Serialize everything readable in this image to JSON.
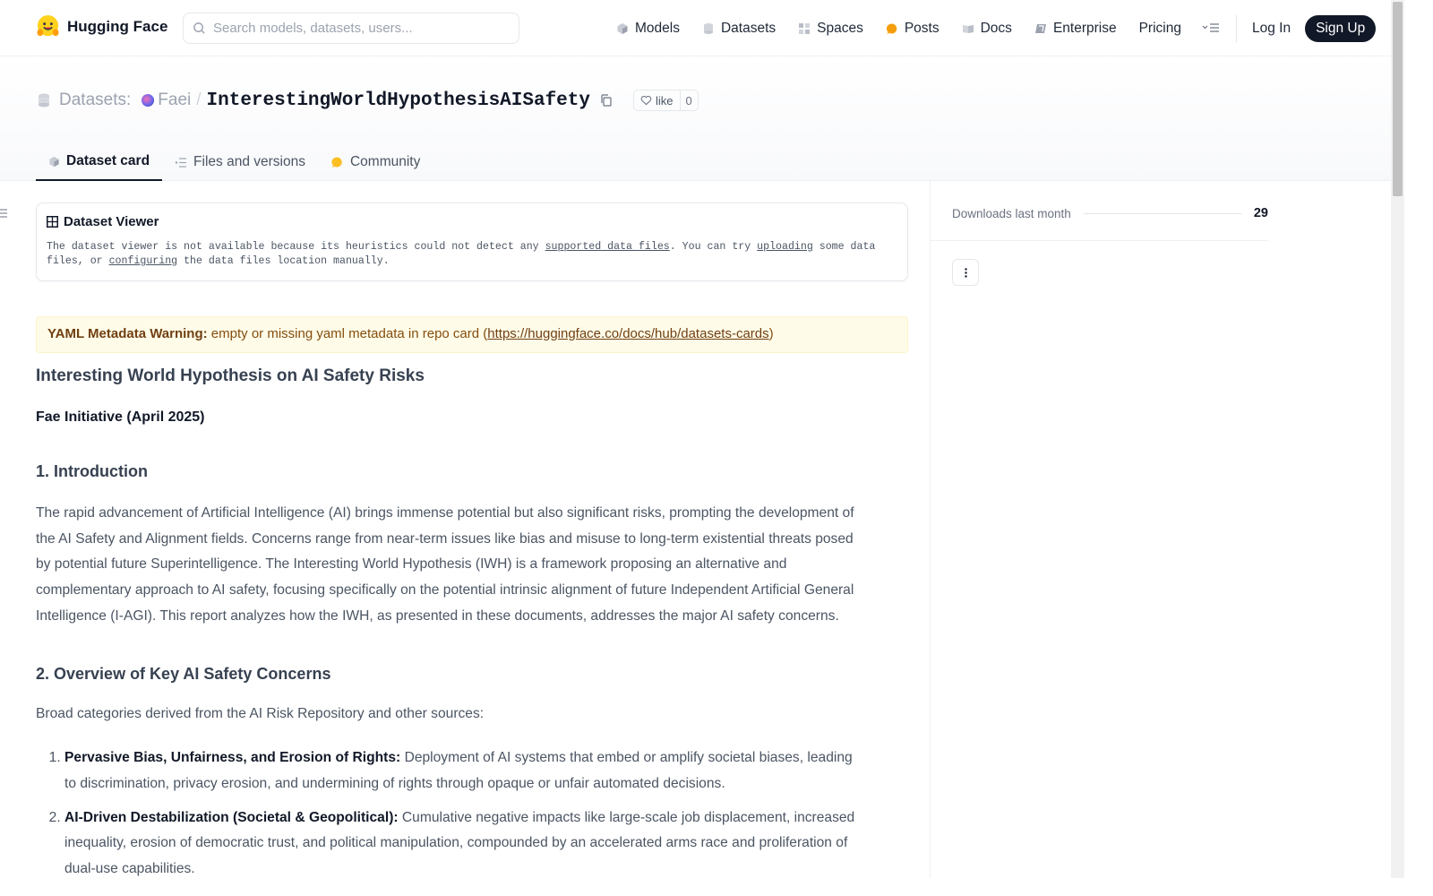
{
  "header": {
    "brand": "Hugging Face",
    "search_placeholder": "Search models, datasets, users...",
    "nav": [
      {
        "label": "Models",
        "icon": "models-icon"
      },
      {
        "label": "Datasets",
        "icon": "datasets-icon"
      },
      {
        "label": "Spaces",
        "icon": "spaces-icon"
      },
      {
        "label": "Posts",
        "icon": "posts-icon"
      },
      {
        "label": "Docs",
        "icon": "docs-icon"
      },
      {
        "label": "Enterprise",
        "icon": "enterprise-icon"
      },
      {
        "label": "Pricing"
      }
    ],
    "login": "Log In",
    "signup": "Sign Up"
  },
  "dataset": {
    "section_label": "Datasets:",
    "owner": "Faei",
    "separator": "/",
    "repo": "InterestingWorldHypothesisAISafety",
    "like_label": "like",
    "like_count": "0",
    "tabs": [
      {
        "label": "Dataset card",
        "active": true
      },
      {
        "label": "Files and versions",
        "active": false
      },
      {
        "label": "Community",
        "active": false
      }
    ]
  },
  "viewer": {
    "title": "Dataset Viewer",
    "text_1": "The dataset viewer is not available because its heuristics could not detect any ",
    "link_1": "supported data files",
    "text_2": ". You can try ",
    "link_2": "uploading",
    "text_3": " some data files, or ",
    "link_3": "configuring",
    "text_4": " the data files location manually."
  },
  "warning": {
    "label": "YAML Metadata Warning:",
    "text": " empty or missing yaml metadata in repo card (",
    "link": "https://huggingface.co/docs/hub/datasets-cards",
    "close": ")"
  },
  "card": {
    "title": "Interesting World Hypothesis on AI Safety Risks",
    "subtitle": "Fae Initiative (April 2025)",
    "sec1_title": "1. Introduction",
    "sec1_body": "The rapid advancement of Artificial Intelligence (AI) brings immense potential but also significant risks, prompting the development of the AI Safety and Alignment fields. Concerns range from near-term issues like bias and misuse to long-term existential threats posed by potential future Superintelligence. The Interesting World Hypothesis (IWH) is a framework proposing an alternative and complementary approach to AI safety, focusing specifically on the potential intrinsic alignment of future Independent Artificial General Intelligence (I-AGI). This report analyzes how the IWH, as presented in these documents, addresses the major AI safety concerns.",
    "sec2_title": "2. Overview of Key AI Safety Concerns",
    "sec2_intro": "Broad categories derived from the AI Risk Repository and other sources:",
    "risks": [
      {
        "title": "Pervasive Bias, Unfairness, and Erosion of Rights:",
        "text": " Deployment of AI systems that embed or amplify societal biases, leading to discrimination, privacy erosion, and undermining of rights through opaque or unfair automated decisions."
      },
      {
        "title": "AI-Driven Destabilization (Societal & Geopolitical):",
        "text": " Cumulative negative impacts like large-scale job displacement, increased inequality, erosion of democratic trust, and political manipulation, compounded by an accelerated arms race and proliferation of dual-use capabilities."
      }
    ]
  },
  "sidebar": {
    "downloads_label": "Downloads last month",
    "downloads_value": "29"
  }
}
